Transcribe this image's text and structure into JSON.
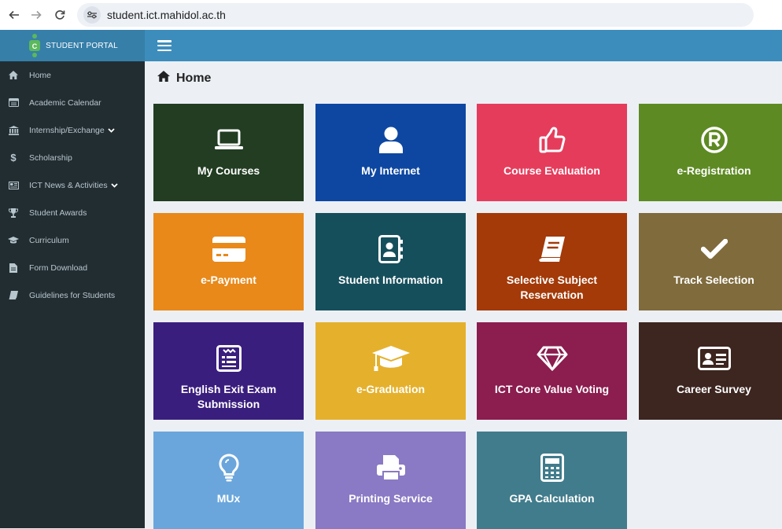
{
  "browser": {
    "url": "student.ict.mahidol.ac.th"
  },
  "brand": {
    "title": "STUDENT PORTAL"
  },
  "sidebar": {
    "items": [
      {
        "label": "Home",
        "icon": "home-icon",
        "expandable": false
      },
      {
        "label": "Academic Calendar",
        "icon": "calendar-icon",
        "expandable": false
      },
      {
        "label": "Internship/Exchange",
        "icon": "institution-icon",
        "expandable": true
      },
      {
        "label": "Scholarship",
        "icon": "dollar-icon",
        "expandable": false
      },
      {
        "label": "ICT News & Activities",
        "icon": "newspaper-icon",
        "expandable": true
      },
      {
        "label": "Student Awards",
        "icon": "trophy-icon",
        "expandable": false
      },
      {
        "label": "Curriculum",
        "icon": "graduation-cap-icon",
        "expandable": false
      },
      {
        "label": "Form Download",
        "icon": "file-icon",
        "expandable": false
      },
      {
        "label": "Guidelines for Students",
        "icon": "book-icon",
        "expandable": false
      }
    ]
  },
  "page": {
    "title": "Home"
  },
  "tiles": [
    {
      "label": "My Courses",
      "icon": "laptop-icon",
      "color": "#223d22"
    },
    {
      "label": "My Internet",
      "icon": "user-icon",
      "color": "#0d47a1"
    },
    {
      "label": "Course Evaluation",
      "icon": "thumbs-up-icon",
      "color": "#e63c5c"
    },
    {
      "label": "e-Registration",
      "icon": "registered-icon",
      "color": "#5d8a22"
    },
    {
      "label": "e-Payment",
      "icon": "credit-card-icon",
      "color": "#e8891a"
    },
    {
      "label": "Student Information",
      "icon": "address-book-icon",
      "color": "#164f5c"
    },
    {
      "label": "Selective Subject Reservation",
      "icon": "book-icon",
      "color": "#a33a08"
    },
    {
      "label": "Track Selection",
      "icon": "check-icon",
      "color": "#7f6b3c"
    },
    {
      "label": "English Exit Exam Submission",
      "icon": "test-form-icon",
      "color": "#3a1e7e"
    },
    {
      "label": "e-Graduation",
      "icon": "graduation-cap-icon",
      "color": "#e5b12c"
    },
    {
      "label": "ICT Core Value Voting",
      "icon": "gem-icon",
      "color": "#8b1d4f"
    },
    {
      "label": "Career Survey",
      "icon": "id-card-icon",
      "color": "#3d2620"
    },
    {
      "label": "MUx",
      "icon": "lightbulb-icon",
      "color": "#6aa6dc"
    },
    {
      "label": "Printing Service",
      "icon": "printer-icon",
      "color": "#8a79c4"
    },
    {
      "label": "GPA Calculation",
      "icon": "calculator-icon",
      "color": "#417c8c"
    }
  ]
}
